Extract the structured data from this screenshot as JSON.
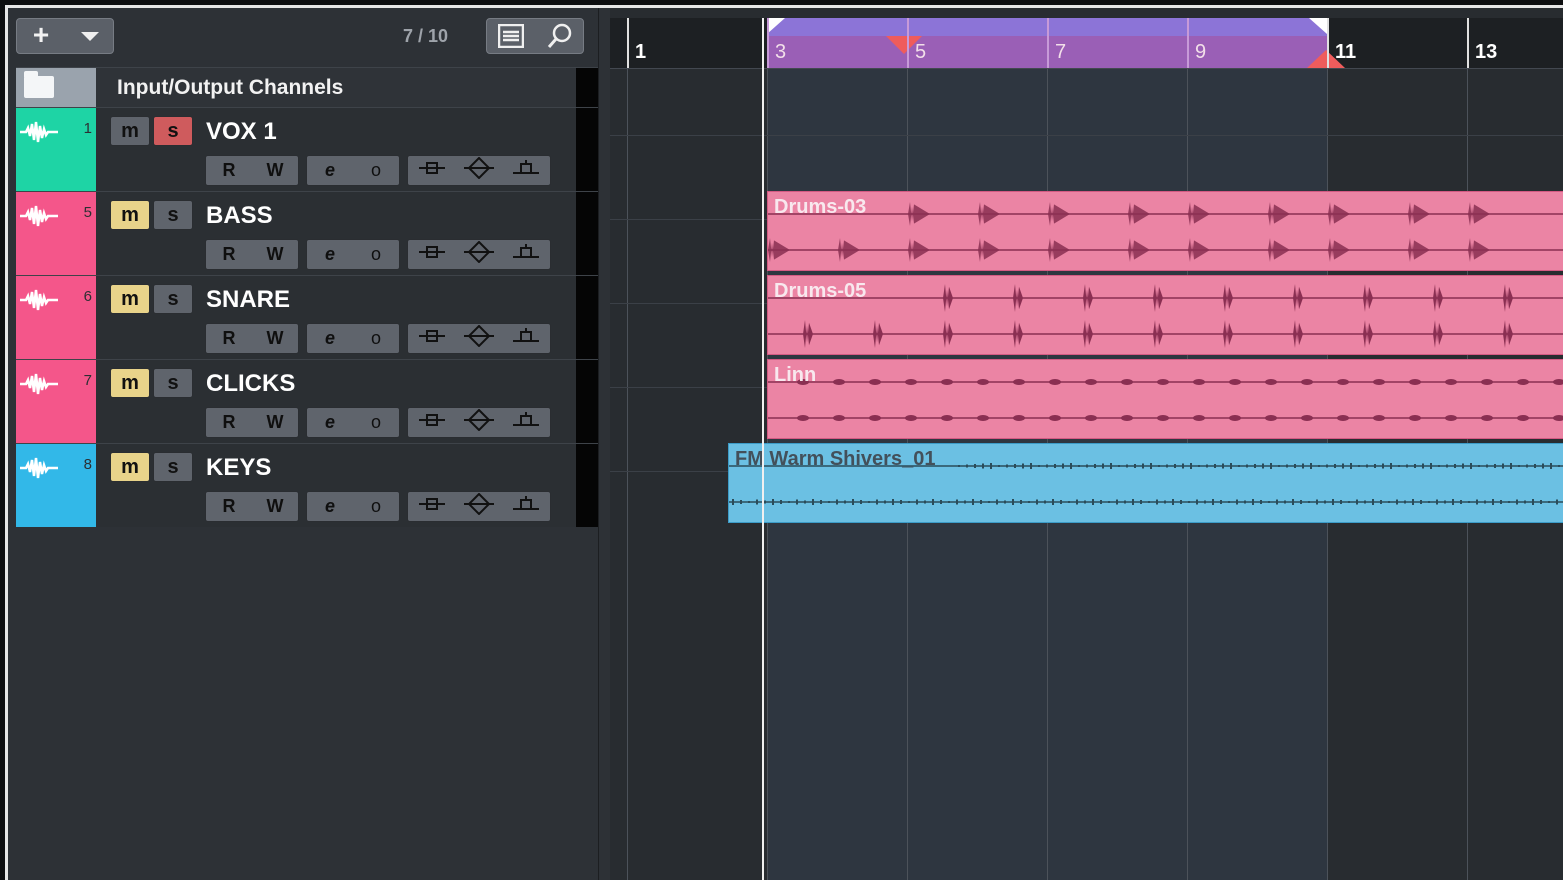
{
  "toolbar": {
    "add_label": "+",
    "track_count": "7 / 10"
  },
  "folder": {
    "name": "Input/Output Channels"
  },
  "tracks": [
    {
      "number": "1",
      "name": "VOX 1",
      "color": "#1ed4a5",
      "mute": false,
      "solo": true
    },
    {
      "number": "5",
      "name": "BASS",
      "color": "#f4568a",
      "mute": true,
      "solo": false
    },
    {
      "number": "6",
      "name": "SNARE",
      "color": "#f4568a",
      "mute": true,
      "solo": false
    },
    {
      "number": "7",
      "name": "CLICKS",
      "color": "#f4568a",
      "mute": true,
      "solo": false
    },
    {
      "number": "8",
      "name": "KEYS",
      "color": "#32b8e8",
      "mute": true,
      "solo": false
    }
  ],
  "buttons": {
    "mute": "m",
    "solo": "s",
    "read": "R",
    "write": "W",
    "edit": "e",
    "monitor": "o"
  },
  "ruler": {
    "bars": [
      "1",
      "3",
      "5",
      "7",
      "9",
      "11",
      "13"
    ]
  },
  "clips": {
    "drums03": "Drums-03",
    "drums05": "Drums-05",
    "linn": "Linn",
    "keys": "FM Warm Shivers_01"
  }
}
